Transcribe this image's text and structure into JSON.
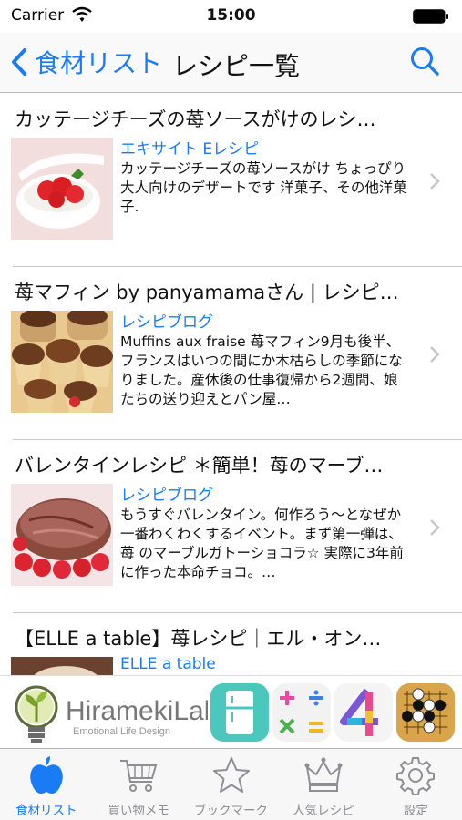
{
  "status": {
    "carrier": "Carrier",
    "time": "15:00"
  },
  "nav": {
    "back_label": "食材リスト",
    "title": "レシピ一覧"
  },
  "recipes": [
    {
      "title": "カッテージチーズの苺ソースがけのレシ…",
      "source": "エキサイト Eレシピ",
      "description": "カッテージチーズの苺ソースがけ ちょっぴり大人向けのデザートです 洋菓子、その他洋菓子."
    },
    {
      "title": "苺マフィン by panyamamaさん | レシピ…",
      "source": "レシピブログ",
      "description": "Muffins aux fraise 苺マフィン9月も後半、フランスはいつの間にか木枯らしの季節になりました。産休後の仕事復帰から2週間、娘たちの送り迎えとパン屋…"
    },
    {
      "title": "バレンタインレシピ ＊簡単！苺のマーブ…",
      "source": "レシピブログ",
      "description": "もうすぐバレンタイン。何作ろう～となぜか一番わくわくするイベント。まず第一弾は、苺 のマーブルガトーショコラ☆ 実際に3年前に作った本命チョコ。…"
    },
    {
      "title": "【ELLE a table】苺レシピ｜エル・オン…",
      "source": "ELLE a table",
      "description": ""
    }
  ],
  "ad": {
    "brand": "HiramekiLab",
    "tagline": "Emotional Life Design"
  },
  "tabs": [
    {
      "label": "食材リスト",
      "icon": "apple-icon",
      "active": true
    },
    {
      "label": "買い物メモ",
      "icon": "cart-icon",
      "active": false
    },
    {
      "label": "ブックマーク",
      "icon": "star-icon",
      "active": false
    },
    {
      "label": "人気レシピ",
      "icon": "crown-icon",
      "active": false
    },
    {
      "label": "設定",
      "icon": "gear-icon",
      "active": false
    }
  ],
  "colors": {
    "accent": "#1a7cf4",
    "tab_inactive": "#8e8e93"
  }
}
